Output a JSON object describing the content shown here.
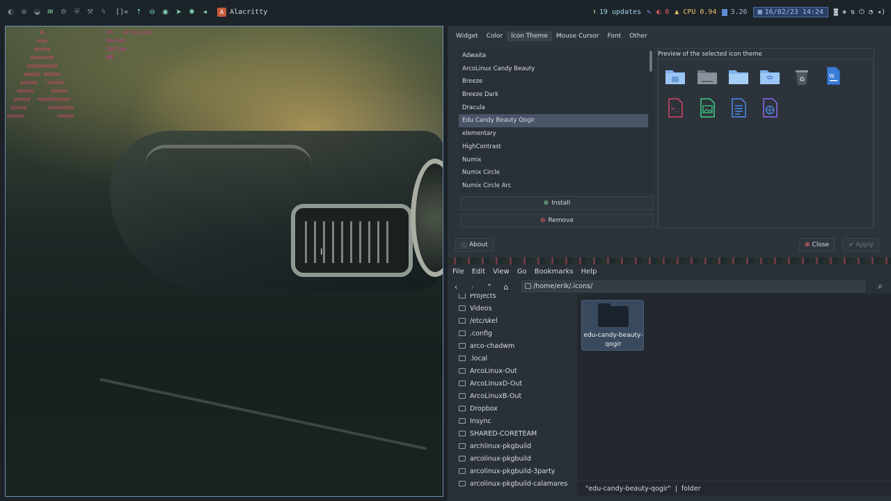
{
  "topbar": {
    "layout": "[]=",
    "window_title": "Alacritty",
    "updates": "19 updates",
    "counter": "0",
    "cpu_label": "CPU",
    "cpu_value": "0.94",
    "mem_value": "3.26",
    "datetime": "16/02/23 14:24"
  },
  "terminal": {
    "ascii_art": "          A\n         ooo\n        ooooo\n       ooooooo\n      ooooooooo\n     ooooo ooooo\n    ooooo   ooooo\n   ooooo     ooooo\n  ooooo  <oooooooo>\n ooooo      <oooooo>\nooooo          <ooo>",
    "info_text": "OS   ArcoLinux\nKernel\nUptime\nWM"
  },
  "appearance": {
    "tabs": [
      "Widget",
      "Color",
      "Icon Theme",
      "Mouse Cursor",
      "Font",
      "Other"
    ],
    "active_tab": 2,
    "themes": [
      "Adwaita",
      "ArcoLinux Candy Beauty",
      "Breeze",
      "Breeze Dark",
      "Dracula",
      "Edu Candy Beauty Qogir",
      "elementary",
      "HighContrast",
      "Numix",
      "Numix Circle",
      "Numix Circle Arc"
    ],
    "selected_theme": 5,
    "install_label": "Install",
    "remove_label": "Remove",
    "preview_label": "Preview of the selected icon theme",
    "about_label": "About",
    "close_label": "Close",
    "apply_label": "Apply",
    "accent": "#4a5467"
  },
  "filemanager": {
    "menu": [
      "File",
      "Edit",
      "View",
      "Go",
      "Bookmarks",
      "Help"
    ],
    "path": "/home/erik/.icons/",
    "sidebar": [
      "Projects",
      "Videos",
      "/etc/skel",
      ".config",
      "arco-chadwm",
      ".local",
      "ArcoLinux-Out",
      "ArcoLinuxD-Out",
      "ArcoLinuxB-Out",
      "Dropbox",
      "Insync",
      "SHARED-CORETEAM",
      "archlinux-pkgbuild",
      "arcolinux-pkgbuild",
      "arcolinux-pkgbuild-3party",
      "arcolinux-pkgbuild-calamares"
    ],
    "file_name_line1": "edu-candy-beauty-",
    "file_name_line2": "qogir",
    "status_name": "\"edu-candy-beauty-qogir\"",
    "status_sep": "|",
    "status_type": "folder"
  }
}
